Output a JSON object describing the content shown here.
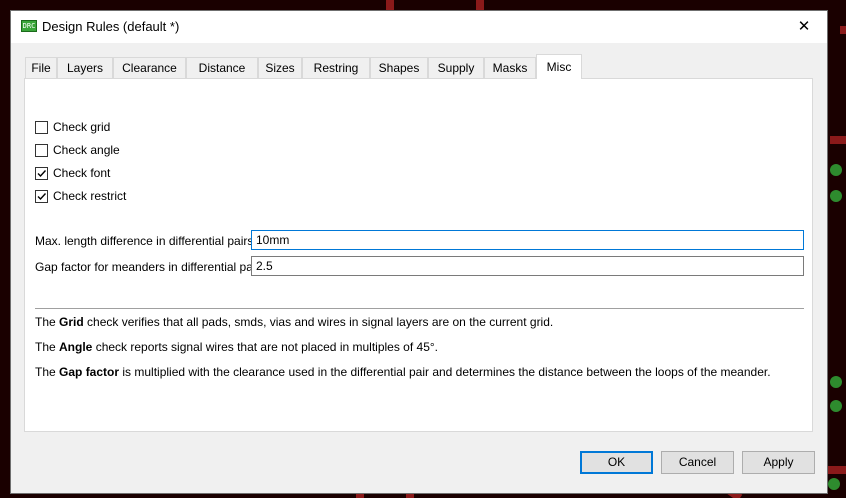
{
  "window": {
    "title": "Design Rules (default *)",
    "icon": "eagle-app-icon",
    "icon_text": "DRC"
  },
  "tabs": [
    {
      "label": "File"
    },
    {
      "label": "Layers"
    },
    {
      "label": "Clearance"
    },
    {
      "label": "Distance"
    },
    {
      "label": "Sizes"
    },
    {
      "label": "Restring"
    },
    {
      "label": "Shapes"
    },
    {
      "label": "Supply"
    },
    {
      "label": "Masks"
    },
    {
      "label": "Misc",
      "active": true
    }
  ],
  "checks": [
    {
      "label": "Check grid",
      "checked": false
    },
    {
      "label": "Check angle",
      "checked": false
    },
    {
      "label": "Check font",
      "checked": true
    },
    {
      "label": "Check restrict",
      "checked": true
    }
  ],
  "fields": {
    "max_length": {
      "label": "Max. length difference in differential pairs",
      "value": "10mm"
    },
    "gap_factor": {
      "label": "Gap factor for meanders in differential pairs",
      "value": "2.5"
    }
  },
  "help": {
    "grid": {
      "pre": "The ",
      "bold": "Grid",
      "post": " check verifies that all pads, smds, vias and wires in signal layers are on the current grid."
    },
    "angle": {
      "pre": "The ",
      "bold": "Angle",
      "post": " check reports signal wires that are not placed in multiples of 45°."
    },
    "gap": {
      "pre": "The ",
      "bold": "Gap factor",
      "post": " is multiplied with the clearance used in the differential pair and determines the distance between the loops of the meander."
    }
  },
  "buttons": {
    "ok": "OK",
    "cancel": "Cancel",
    "apply": "Apply"
  },
  "colors": {
    "accent": "#0078d7",
    "pcb_bg": "#1a0000",
    "trace": "#8b1a1a",
    "pad": "#2e8b2e"
  }
}
